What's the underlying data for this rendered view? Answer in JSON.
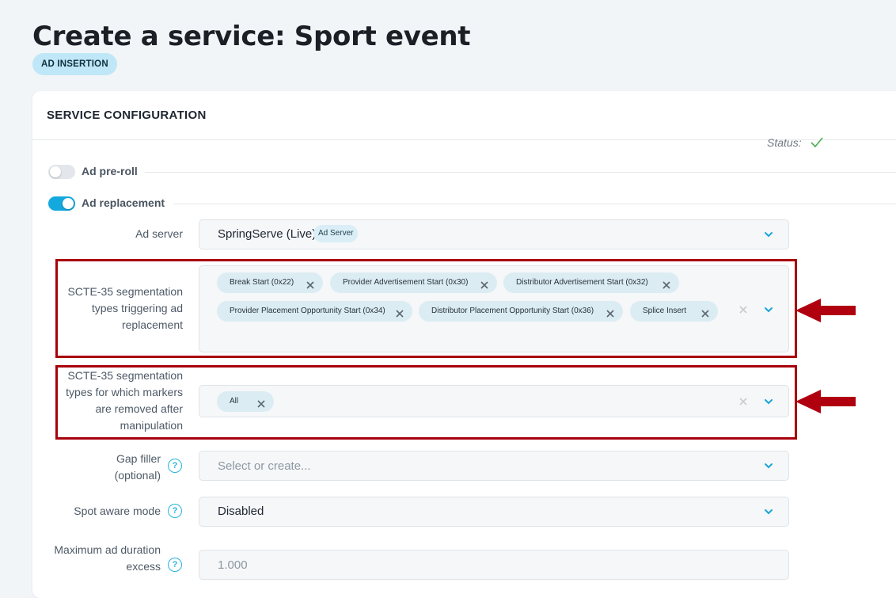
{
  "page": {
    "title": "Create a service: Sport event",
    "badge": "AD INSERTION"
  },
  "card": {
    "title": "SERVICE CONFIGURATION"
  },
  "toggles": {
    "preroll": {
      "label": "Ad pre-roll",
      "on": false
    },
    "replacement": {
      "label": "Ad replacement",
      "on": true
    }
  },
  "ad_server": {
    "label": "Ad server",
    "value": "SpringServe (Live)",
    "tag": "Ad Server",
    "status_label": "Status:",
    "status_color": "#4caf50"
  },
  "scte_triggering": {
    "label_lines": [
      "SCTE-35 segmentation",
      "types triggering ad",
      "replacement"
    ],
    "chips": [
      "Break Start (0x22)",
      "Provider Advertisement Start (0x30)",
      "Distributor Advertisement Start (0x32)",
      "Provider Placement Opportunity Start (0x34)",
      "Distributor Placement Opportunity Start (0x36)",
      "Splice Insert"
    ]
  },
  "scte_removed": {
    "label_lines": [
      "SCTE-35 segmentation",
      "types for which markers",
      "are removed after",
      "manipulation"
    ],
    "chips": [
      "All"
    ]
  },
  "gap_filler": {
    "label_lines": [
      "Gap filler",
      "(optional)"
    ],
    "placeholder": "Select or create..."
  },
  "spot_aware": {
    "label": "Spot aware mode",
    "value": "Disabled"
  },
  "max_ad_duration": {
    "label_lines": [
      "Maximum ad duration",
      "excess"
    ],
    "value": "1.000"
  },
  "colors": {
    "accent": "#13a9de",
    "highlight": "#a8000c"
  }
}
